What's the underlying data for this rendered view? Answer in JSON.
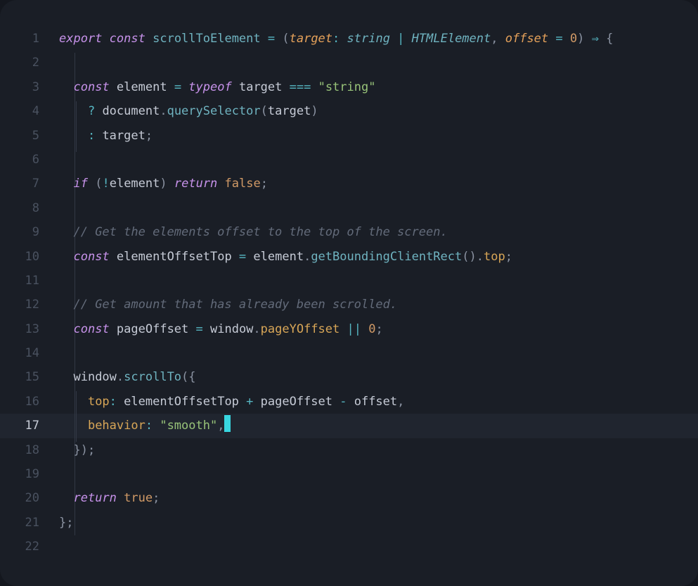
{
  "editor": {
    "cursor_line": 17,
    "line_numbers": [
      "1",
      "2",
      "3",
      "4",
      "5",
      "6",
      "7",
      "8",
      "9",
      "10",
      "11",
      "12",
      "13",
      "14",
      "15",
      "16",
      "17",
      "18",
      "19",
      "20",
      "21",
      "22"
    ],
    "lines": {
      "l1": {
        "export": "export",
        "const": "const",
        "fn": "scrollToElement",
        "eq": " = ",
        "lp": "(",
        "p1": "target",
        "colon1": ": ",
        "t1": "string",
        "pipe": " | ",
        "t2": "HTMLElement",
        "comma": ", ",
        "p2": "offset",
        "eq2": " = ",
        "zero": "0",
        "rp": ")",
        "arrow": " ⇒ ",
        "lb": "{"
      },
      "l3": {
        "ind": "  ",
        "const": "const",
        "sp": " ",
        "var": "element",
        "eq": " = ",
        "typeof": "typeof",
        "sp2": " ",
        "tgt": "target",
        "teq": " === ",
        "str": "\"string\""
      },
      "l4": {
        "ind": "    ",
        "q": "? ",
        "doc": "document",
        "dot": ".",
        "qs": "querySelector",
        "lp": "(",
        "tgt": "target",
        "rp": ")"
      },
      "l5": {
        "ind": "    ",
        "colon": ": ",
        "tgt": "target",
        "semi": ";"
      },
      "l7": {
        "ind": "  ",
        "if": "if",
        "sp": " ",
        "lp": "(",
        "bang": "!",
        "el": "element",
        "rp": ")",
        "sp2": " ",
        "ret": "return",
        "sp3": " ",
        "false": "false",
        "semi": ";"
      },
      "l9": {
        "ind": "  ",
        "c": "// Get the elements offset to the top of the screen."
      },
      "l10": {
        "ind": "  ",
        "const": "const",
        "sp": " ",
        "var": "elementOffsetTop",
        "eq": " = ",
        "el": "element",
        "dot": ".",
        "gb": "getBoundingClientRect",
        "paren": "()",
        "dot2": ".",
        "top": "top",
        "semi": ";"
      },
      "l12": {
        "ind": "  ",
        "c": "// Get amount that has already been scrolled."
      },
      "l13": {
        "ind": "  ",
        "const": "const",
        "sp": " ",
        "var": "pageOffset",
        "eq": " = ",
        "win": "window",
        "dot": ".",
        "pyo": "pageYOffset",
        "or": " || ",
        "zero": "0",
        "semi": ";"
      },
      "l15": {
        "ind": "  ",
        "win": "window",
        "dot": ".",
        "st": "scrollTo",
        "lp": "(",
        "lb": "{"
      },
      "l16": {
        "ind": "    ",
        "top": "top",
        "colon": ": ",
        "eot": "elementOffsetTop",
        "plus": " + ",
        "po": "pageOffset",
        "minus": " - ",
        "off": "offset",
        "comma": ","
      },
      "l17": {
        "ind": "    ",
        "beh": "behavior",
        "colon": ": ",
        "str": "\"smooth\"",
        "comma": ","
      },
      "l18": {
        "ind": "  ",
        "rb": "}",
        "rp": ")",
        "semi": ";"
      },
      "l20": {
        "ind": "  ",
        "ret": "return",
        "sp": " ",
        "true": "true",
        "semi": ";"
      },
      "l21": {
        "rb": "}",
        "semi": ";"
      }
    }
  }
}
